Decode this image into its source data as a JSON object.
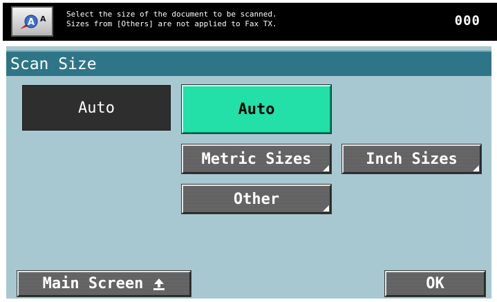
{
  "header": {
    "message_line1": "Select the size of the document to be scanned.",
    "message_line2": "Sizes from [Others] are not applied to Fax TX.",
    "counter": "000",
    "accessibility_icon": "accessibility-icon"
  },
  "panel": {
    "title": "Scan Size",
    "current_value": "Auto",
    "options": {
      "auto": "Auto",
      "metric": "Metric Sizes",
      "inch": "Inch Sizes",
      "other": "Other"
    },
    "selected_option": "Auto"
  },
  "footer": {
    "main_screen_label": "Main Screen",
    "main_screen_icon": "return-arrow-icon",
    "ok_label": "OK"
  },
  "colors": {
    "panel_bg": "#a7c8d1",
    "title_bar": "#2f7588",
    "selected": "#22e0a8",
    "current_value_bg": "#2e2e2e"
  }
}
